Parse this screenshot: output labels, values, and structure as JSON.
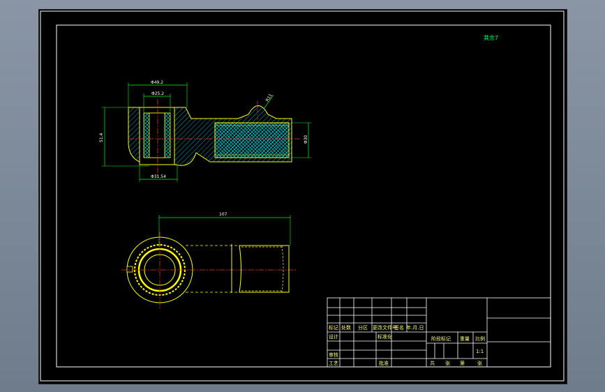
{
  "sheet": {
    "label_top_right": "其余7",
    "frame_color": "#ffffff",
    "part_color": "#ffff00",
    "dim_color": "#00ff00",
    "center_color": "#ff3333",
    "hatch_color": "#00cccc"
  },
  "dimensions": {
    "top_od": "Φ49.2",
    "top_id": "Φ25.2",
    "left_height": "51.4",
    "radius": "R11",
    "right_dia": "Φ30",
    "bottom_bore": "Φ31.54",
    "length": "107"
  },
  "title_block": {
    "header_row": [
      "标记",
      "处数",
      "分区",
      "更改文件号",
      "签名",
      "年.月.日"
    ],
    "row_design": [
      "设计",
      "标准化"
    ],
    "row_review": "审核",
    "row_process": [
      "工艺",
      "批准"
    ],
    "stage_labels": [
      "阶段标记",
      "重量",
      "比例"
    ],
    "scale": "1:1",
    "sheet_info": [
      "共",
      "张",
      "第",
      "张"
    ]
  }
}
